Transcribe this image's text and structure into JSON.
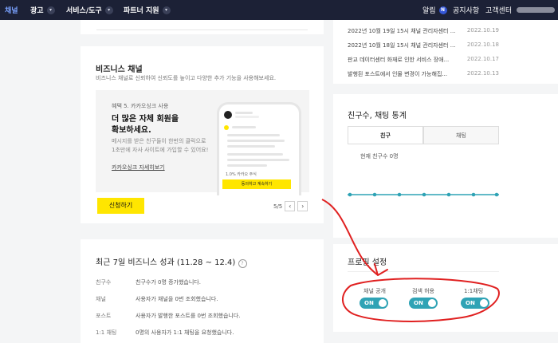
{
  "nav": {
    "items": [
      {
        "label": "채널"
      },
      {
        "label": "광고"
      },
      {
        "label": "서비스/도구"
      },
      {
        "label": "파트너 지원"
      }
    ],
    "alarm_label": "알림",
    "alarm_badge": "N",
    "notice_label": "공지사항",
    "customer_center_label": "고객센터"
  },
  "business_card": {
    "title": "비즈니스 채널",
    "description": "비즈니스 채널로 신뢰하여 신뢰도를 높이고 다양한 추가 기능을 사용해보세요.",
    "promo_tag": "혜택 5. 카카오싱크 사용",
    "promo_title_1": "더 많은 자체 회원을",
    "promo_title_2": "확보하세요.",
    "promo_text_1": "메시지를 받은 친구들이 한번의 클릭으로",
    "promo_text_2": "1초만에 자사 사이트에 가입할 수 있어요!",
    "promo_link": "카카오싱크 자세히보기",
    "apply_button": "신청하기",
    "pager": "5/5",
    "phone_button": "동의하고 계속하기",
    "phone_sub": "1.0% 카카오 주식"
  },
  "performance": {
    "title": "최근 7일 비즈니스 성과 (11.28 ~ 12.4)",
    "rows": [
      {
        "label": "친구수",
        "value": "친구수가 0명 증가했습니다."
      },
      {
        "label": "채널",
        "value": "사용자가 채널을 0번 조회했습니다."
      },
      {
        "label": "포스트",
        "value": "사용자가 발행한 포스트를 0번 조회했습니다."
      },
      {
        "label": "1:1 채팅",
        "value": "0명의 사용자가 1:1 채팅을 요청했습니다."
      }
    ]
  },
  "notices": [
    {
      "title": "2022년 10월 19일 15시 채널 관리자센터 ...",
      "date": "2022.10.19"
    },
    {
      "title": "2022년 10월 18일 15시 채널 관리자센터 ...",
      "date": "2022.10.18"
    },
    {
      "title": "판교 데이터센터 화재로 인한 서비스 장애...",
      "date": "2022.10.17"
    },
    {
      "title": "발행된 포스트에서 인물 변경이 가능해집...",
      "date": "2022.10.13"
    }
  ],
  "stats": {
    "title": "친구수, 채팅 통계",
    "tab_friends": "친구",
    "tab_chat": "채팅",
    "total_friends": "현재 친구수 0명",
    "line_color": "#2fa3b5"
  },
  "profile_settings": {
    "title": "프로필 설정",
    "toggles": [
      {
        "label": "채널 공개",
        "state": "ON"
      },
      {
        "label": "검색 허용",
        "state": "ON"
      },
      {
        "label": "1:1채팅",
        "state": "ON"
      }
    ]
  },
  "annotation_color": "#e02020"
}
